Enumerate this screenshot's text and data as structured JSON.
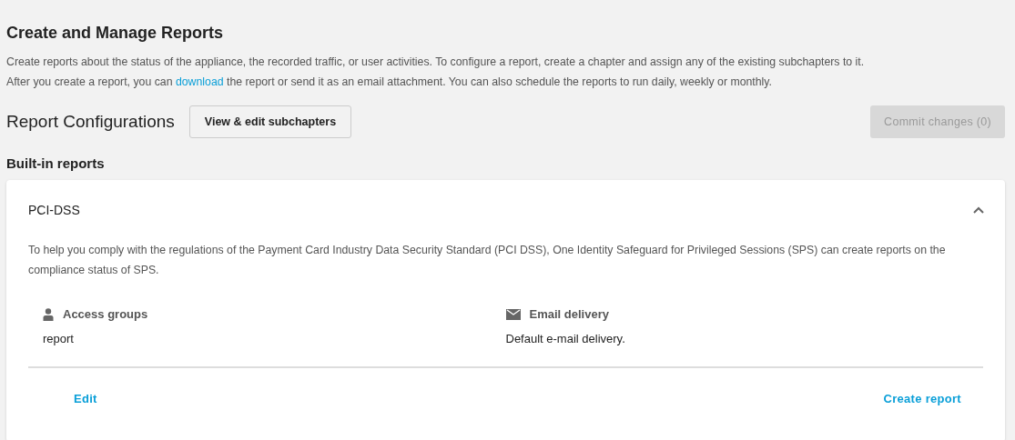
{
  "page": {
    "title": "Create and Manage Reports",
    "intro": [
      {
        "text": "Create reports about the status of the appliance, the recorded traffic, or user activities. To configure a report, create a chapter and assign any of the existing subchapters to it."
      },
      {
        "before": "After you create a report, you can ",
        "link": "download",
        "after": " the report or send it as an email attachment. You can also schedule the reports to run daily, weekly or monthly."
      }
    ]
  },
  "toolbar": {
    "title": "Report Configurations",
    "subchapters_button": "View & edit subchapters",
    "commit_button": {
      "label": "Commit changes (0)",
      "disabled": true
    }
  },
  "section": {
    "title": "Built-in reports"
  },
  "reports": [
    {
      "name": "PCI-DSS",
      "expanded": true,
      "description": "To help you comply with the regulations of the Payment Card Industry Data Security Standard (PCI DSS), One Identity Safeguard for Privileged Sessions (SPS) can create reports on the compliance status of SPS.",
      "fields": [
        {
          "kind": "user",
          "label": "Access groups",
          "value": "report"
        },
        {
          "kind": "mail",
          "label": "Email delivery",
          "value": "Default e-mail delivery."
        }
      ],
      "actions": [
        "Edit",
        "Create report"
      ]
    }
  ]
}
